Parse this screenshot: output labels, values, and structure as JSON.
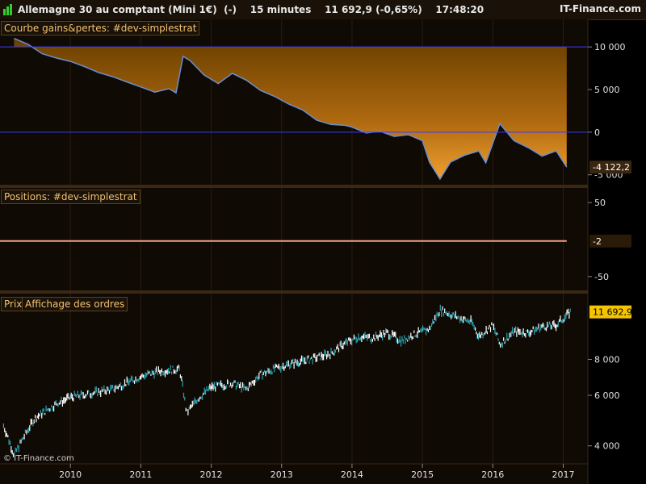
{
  "header": {
    "instrument": "Allemagne 30 au comptant (Mini 1€)",
    "flag": "(-)",
    "interval": "15 minutes",
    "price": "11 692,9",
    "change": "(-0,65%)",
    "time": "17:48:20",
    "brand": "IT-Finance.com"
  },
  "panels": {
    "pnl": {
      "label": "Courbe gains&pertes: #dev-simplestrat",
      "ticks": [
        "10 000",
        "5 000",
        "0",
        "-5 000"
      ],
      "last": "-4 122,2"
    },
    "positions": {
      "label": "Positions: #dev-simplestrat",
      "ticks": [
        "50",
        "0",
        "-50"
      ],
      "last": "-2"
    },
    "price": {
      "label_a": "Prix",
      "label_b": "Affichage des ordres",
      "ticks": [
        "8 000",
        "6 000",
        "4 000"
      ],
      "last": "11 692,9",
      "watermark": "© IT-Finance.com"
    }
  },
  "xaxis": {
    "labels": [
      "2010",
      "2011",
      "2012",
      "2013",
      "2014",
      "2015",
      "2016",
      "2017"
    ]
  },
  "colors": {
    "accent": "#e89a2a",
    "line_blue": "#6a8fd0",
    "positions_line": "#f0a080",
    "price_bar": "#ffffff",
    "price_bar2": "#2aa0b0",
    "label_bg": "#f5c400"
  },
  "chart_data": [
    {
      "type": "area",
      "title": "Courbe gains&pertes: #dev-simplestrat",
      "x": [
        2009.2,
        2009.4,
        2009.6,
        2009.8,
        2010.0,
        2010.2,
        2010.4,
        2010.6,
        2010.8,
        2011.0,
        2011.2,
        2011.4,
        2011.5,
        2011.6,
        2011.7,
        2011.9,
        2012.1,
        2012.3,
        2012.5,
        2012.7,
        2012.9,
        2013.1,
        2013.3,
        2013.5,
        2013.7,
        2013.9,
        2014.0,
        2014.2,
        2014.4,
        2014.6,
        2014.8,
        2015.0,
        2015.1,
        2015.25,
        2015.4,
        2015.6,
        2015.8,
        2015.9,
        2016.1,
        2016.3,
        2016.5,
        2016.7,
        2016.9,
        2017.05
      ],
      "values": [
        11000,
        10300,
        9200,
        8700,
        8300,
        7700,
        7000,
        6500,
        5900,
        5300,
        4700,
        5100,
        4600,
        8900,
        8400,
        6700,
        5700,
        6900,
        6100,
        4900,
        4200,
        3300,
        2600,
        1400,
        900,
        800,
        600,
        -100,
        100,
        -500,
        -300,
        -1000,
        -3500,
        -5500,
        -3500,
        -2700,
        -2200,
        -3600,
        1000,
        -1000,
        -1800,
        -2800,
        -2200,
        -4100
      ],
      "ylim": [
        -5500,
        12000
      ],
      "last_label": "-4 122,2"
    },
    {
      "type": "line",
      "title": "Positions: #dev-simplestrat",
      "x": [
        2009.0,
        2017.05
      ],
      "values": [
        -2,
        -2
      ],
      "ylim": [
        -60,
        60
      ],
      "last_label": "-2"
    },
    {
      "type": "line",
      "title": "Prix",
      "x": [
        2009.05,
        2009.2,
        2009.5,
        2009.8,
        2010.0,
        2010.3,
        2010.6,
        2010.9,
        2011.1,
        2011.3,
        2011.55,
        2011.65,
        2011.8,
        2012.0,
        2012.3,
        2012.5,
        2012.7,
        2012.9,
        2013.1,
        2013.3,
        2013.5,
        2013.7,
        2013.9,
        2014.1,
        2014.3,
        2014.5,
        2014.7,
        2014.9,
        2015.1,
        2015.25,
        2015.5,
        2015.7,
        2015.8,
        2016.0,
        2016.1,
        2016.3,
        2016.5,
        2016.7,
        2016.9,
        2017.1
      ],
      "values": [
        4700,
        3700,
        5000,
        5600,
        5900,
        6100,
        6300,
        6800,
        7100,
        7300,
        7400,
        5200,
        5800,
        6400,
        6600,
        6300,
        7100,
        7400,
        7700,
        7900,
        8100,
        8400,
        9100,
        9600,
        9500,
        9900,
        9300,
        9800,
        10200,
        11900,
        11200,
        10800,
        9600,
        10500,
        9000,
        10000,
        9900,
        10400,
        10500,
        11700
      ],
      "ylim": [
        3600,
        12700
      ],
      "scale": "log",
      "last_label": "11 692,9"
    }
  ]
}
